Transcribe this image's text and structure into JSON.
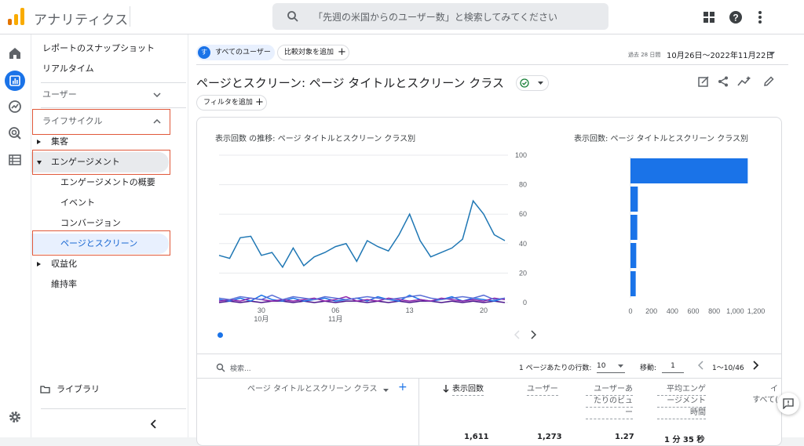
{
  "app": {
    "title": "アナリティクス"
  },
  "search": {
    "placeholder": "「先週の米国からのユーザー数」と検索してみてください"
  },
  "nav": {
    "snapshot": "レポートのスナップショット",
    "realtime": "リアルタイム",
    "user": "ユーザー",
    "lifecycle": "ライフサイクル",
    "acquisition": "集客",
    "engagement": "エンゲージメント",
    "engagement_overview": "エンゲージメントの概要",
    "events": "イベント",
    "conversions": "コンバージョン",
    "pages_screens": "ページとスクリーン",
    "monetization": "収益化",
    "retention": "維持率",
    "library": "ライブラリ"
  },
  "header": {
    "segment_badge": "す",
    "segment": "すべてのユーザー",
    "compare": "比較対象を追加",
    "date_prefix": "過去 28 日間",
    "date_range": "10月26日〜2022年11月22日",
    "page_title": "ページとスクリーン: ページ タイトルとスクリーン クラス",
    "filter": "フィルタを追加"
  },
  "chart_left": {
    "title": "表示回数 の推移: ページ タイトルとスクリーン クラス別",
    "y_ticks": [
      "100",
      "80",
      "60",
      "40",
      "20",
      "0"
    ],
    "x_ticks": [
      "30",
      "06",
      "13",
      "20"
    ],
    "x_months": [
      "10月",
      "11月"
    ]
  },
  "chart_right": {
    "title": "表示回数: ページ タイトルとスクリーン クラス別",
    "x_ticks": [
      "0",
      "200",
      "400",
      "600",
      "800",
      "1,000",
      "1,200"
    ]
  },
  "chart_data": [
    {
      "type": "line",
      "title": "表示回数 の推移: ページ タイトルとスクリーン クラス別",
      "x": [
        "10/26",
        "10/27",
        "10/28",
        "10/29",
        "10/30",
        "10/31",
        "11/01",
        "11/02",
        "11/03",
        "11/04",
        "11/05",
        "11/06",
        "11/07",
        "11/08",
        "11/09",
        "11/10",
        "11/11",
        "11/12",
        "11/13",
        "11/14",
        "11/15",
        "11/16",
        "11/17",
        "11/18",
        "11/19",
        "11/20",
        "11/21",
        "11/22"
      ],
      "ylim": [
        0,
        100
      ],
      "series": [
        {
          "values": [
            32,
            30,
            44,
            45,
            32,
            34,
            24,
            37,
            25,
            31,
            34,
            38,
            40,
            28,
            42,
            38,
            35,
            46,
            60,
            42,
            31,
            34,
            37,
            43,
            69,
            60,
            46,
            42
          ],
          "color": "#1f77b4"
        },
        {
          "values": [
            3,
            2,
            4,
            3,
            2,
            5,
            2,
            4,
            3,
            2,
            4,
            3,
            2,
            3,
            4,
            3,
            2,
            3,
            4,
            5,
            3,
            2,
            3,
            4,
            3,
            5,
            2,
            3
          ],
          "color": "#5b6fd6"
        },
        {
          "values": [
            1,
            2,
            1,
            3,
            2,
            1,
            2,
            1,
            2,
            3,
            1,
            2,
            4,
            1,
            2,
            1,
            3,
            2,
            1,
            2,
            1,
            3,
            2,
            1,
            2,
            1,
            3,
            2
          ],
          "color": "#8e24aa"
        },
        {
          "values": [
            2,
            1,
            3,
            1,
            5,
            2,
            1,
            3,
            1,
            2,
            3,
            1,
            2,
            3,
            1,
            4,
            2,
            1,
            5,
            2,
            1,
            2,
            4,
            1,
            3,
            2,
            1,
            3
          ],
          "color": "#1a73e8"
        },
        {
          "values": [
            0,
            1,
            0,
            1,
            0,
            1,
            1,
            0,
            1,
            0,
            1,
            0,
            1,
            1,
            0,
            1,
            0,
            1,
            0,
            1,
            1,
            0,
            1,
            0,
            1,
            0,
            1,
            0
          ],
          "color": "#4a148c"
        }
      ]
    },
    {
      "type": "bar",
      "title": "表示回数: ページ タイトルとスクリーン クラス別",
      "orientation": "horizontal",
      "values": [
        1120,
        70,
        65,
        55,
        50
      ],
      "xlim": [
        0,
        1200
      ]
    }
  ],
  "table": {
    "search_placeholder": "検索...",
    "rows_per_page_label": "1 ページあたりの行数:",
    "rows_per_page": "10",
    "goto_label": "移動:",
    "goto_value": "1",
    "range": "1〜10/46",
    "col_dimension": "ページ タイトルとスクリーン クラス",
    "col_views": "表示回数",
    "col_users": "ユーザー",
    "col_views_per_user": [
      "ユーザーあ",
      "たりのビュ",
      "ー"
    ],
    "col_avg_engagement": [
      "平均エンゲ",
      "ージメント",
      "時間"
    ],
    "col_partial": [
      "イ",
      "すべて("
    ],
    "total_views": "1,611",
    "total_users": "1,273",
    "total_vpu": "1.27",
    "total_avg": "1 分 35 秒"
  },
  "colors": {
    "accent": "#1a73e8",
    "highlight": "#e0583a",
    "selected_bg": "#e8f0fe"
  }
}
